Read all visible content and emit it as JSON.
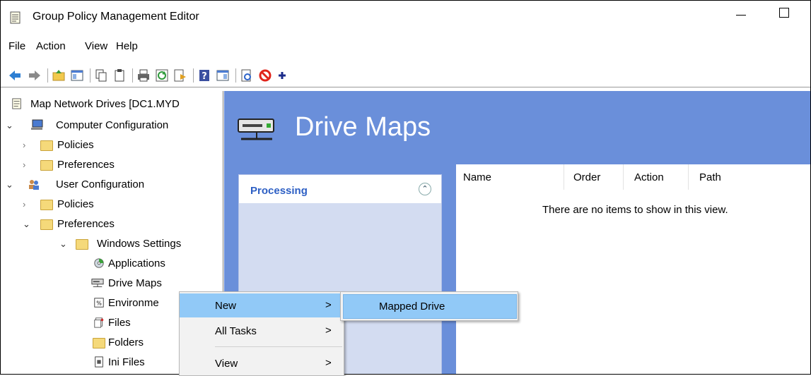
{
  "window": {
    "title": "Group Policy Management Editor"
  },
  "menubar": {
    "items": [
      "File",
      "Action",
      "View",
      "Help"
    ]
  },
  "toolbar": {
    "icons": [
      "back-icon",
      "forward-icon",
      "up-folder-icon",
      "show-hide-tree-icon",
      "copy-icon",
      "paste-icon",
      "print-icon",
      "refresh-icon",
      "export-list-icon",
      "help-icon",
      "show-action-pane-icon",
      "properties-icon",
      "disable-icon",
      "add-icon"
    ]
  },
  "tree": {
    "root": "Map Network Drives [DC1.MYD",
    "computer_config": "Computer Configuration",
    "cc_policies": "Policies",
    "cc_preferences": "Preferences",
    "user_config": "User Configuration",
    "uc_policies": "Policies",
    "uc_preferences": "Preferences",
    "windows_settings": "Windows Settings",
    "applications": "Applications",
    "drive_maps": "Drive Maps",
    "environment": "Environme",
    "files": "Files",
    "folders": "Folders",
    "ini_files": "Ini Files"
  },
  "content": {
    "banner_title": "Drive Maps",
    "processing_title": "Processing",
    "columns": [
      "Name",
      "Order",
      "Action",
      "Path"
    ],
    "empty_message": "There are no items to show in this view."
  },
  "context_menu": {
    "items": [
      {
        "label": "New",
        "arrow": ">"
      },
      {
        "label": "All Tasks",
        "arrow": ">"
      },
      {
        "label": "View",
        "arrow": ">"
      }
    ]
  },
  "submenu": {
    "items": [
      "Mapped Drive"
    ]
  },
  "colors": {
    "banner": "#6a8fda",
    "highlight": "#91c9f7",
    "processing_title": "#2d5fc4"
  }
}
